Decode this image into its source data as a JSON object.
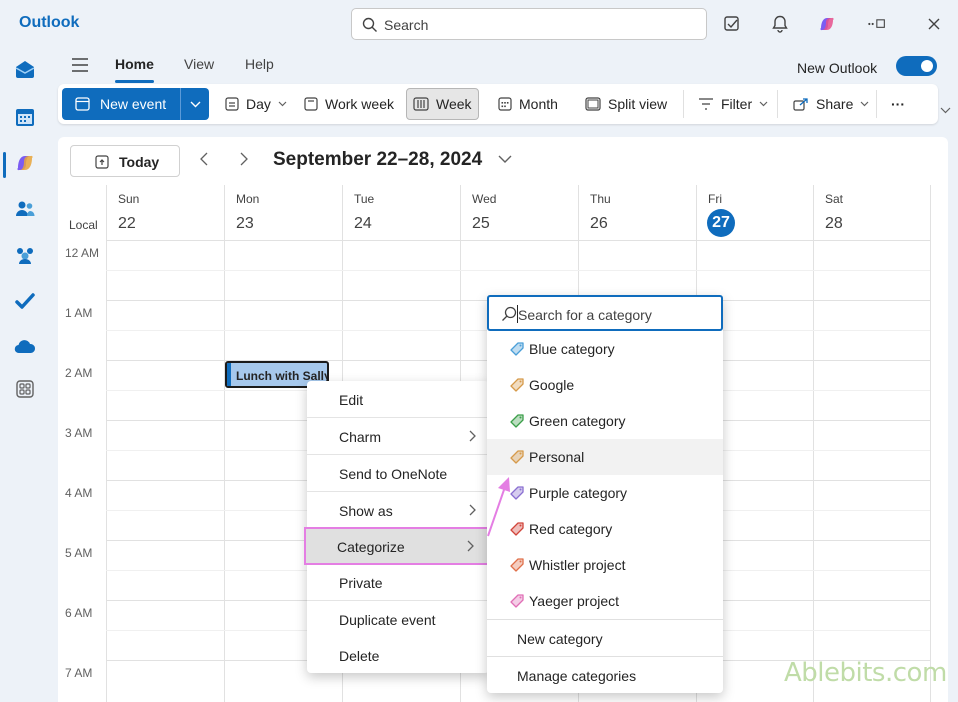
{
  "app": {
    "title": "Outlook"
  },
  "search": {
    "placeholder": "Search"
  },
  "menu_tabs": [
    "Home",
    "View",
    "Help"
  ],
  "new_outlook": {
    "label": "New Outlook",
    "enabled": true
  },
  "ribbon": {
    "new_event": "New event",
    "day": "Day",
    "work_week": "Work week",
    "week": "Week",
    "month": "Month",
    "split_view": "Split view",
    "filter": "Filter",
    "share": "Share",
    "more": "···"
  },
  "calendar": {
    "today_label": "Today",
    "range": "September 22–28, 2024",
    "timezone_label": "Local",
    "days": [
      {
        "name": "Sun",
        "num": "22"
      },
      {
        "name": "Mon",
        "num": "23"
      },
      {
        "name": "Tue",
        "num": "24"
      },
      {
        "name": "Wed",
        "num": "25"
      },
      {
        "name": "Thu",
        "num": "26"
      },
      {
        "name": "Fri",
        "num": "27"
      },
      {
        "name": "Sat",
        "num": "28"
      }
    ],
    "today_index": 5,
    "hours": [
      "12 AM",
      "1 AM",
      "2 AM",
      "3 AM",
      "4 AM",
      "5 AM",
      "6 AM",
      "7 AM"
    ],
    "event": {
      "title": "Lunch with Sally"
    }
  },
  "context_menu": {
    "items": [
      "Edit",
      "Charm",
      "Send to OneNote",
      "Show as",
      "Categorize",
      "Private",
      "Duplicate event",
      "Delete"
    ]
  },
  "category_menu": {
    "search_placeholder": "Search for a category",
    "categories": [
      {
        "name": "Blue category",
        "color": "#4a9fd8"
      },
      {
        "name": "Google",
        "color": "#d69a4a"
      },
      {
        "name": "Green category",
        "color": "#3c9f4a"
      },
      {
        "name": "Personal",
        "color": "#d69a4a"
      },
      {
        "name": "Purple category",
        "color": "#8a6fd1"
      },
      {
        "name": "Red category",
        "color": "#d1453b"
      },
      {
        "name": "Whistler project",
        "color": "#e0704a"
      },
      {
        "name": "Yaeger project",
        "color": "#e06fb6"
      }
    ],
    "new_category": "New category",
    "manage_categories": "Manage categories"
  },
  "watermark": "Ablebits.com",
  "colors": {
    "accent": "#0f6cbd",
    "highlight": "#e47ee3"
  }
}
